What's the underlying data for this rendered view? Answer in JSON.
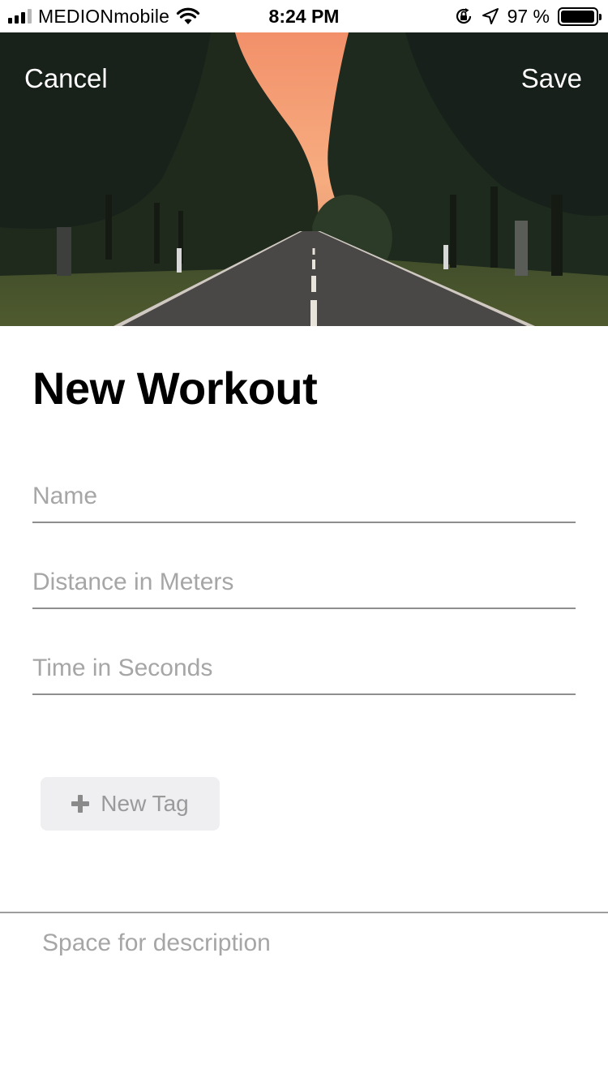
{
  "status_bar": {
    "carrier": "MEDIONmobile",
    "time": "8:24 PM",
    "battery_text": "97 %",
    "battery_level": 0.97,
    "icons": [
      "signal-icon",
      "wifi-icon",
      "orientation-lock-icon",
      "location-arrow-icon",
      "battery-icon"
    ]
  },
  "header": {
    "cancel_label": "Cancel",
    "save_label": "Save"
  },
  "page": {
    "title": "New Workout"
  },
  "form": {
    "name": {
      "value": "",
      "placeholder": "Name"
    },
    "distance": {
      "value": "",
      "placeholder": "Distance in Meters"
    },
    "time": {
      "value": "",
      "placeholder": "Time in Seconds"
    },
    "new_tag_label": "New Tag",
    "description": {
      "value": "",
      "placeholder": "Space for description"
    }
  },
  "colors": {
    "placeholder": "#a6a6a6",
    "underline": "#8e8e8e",
    "tag_background": "#efeff2",
    "sky": "#f6a878"
  }
}
